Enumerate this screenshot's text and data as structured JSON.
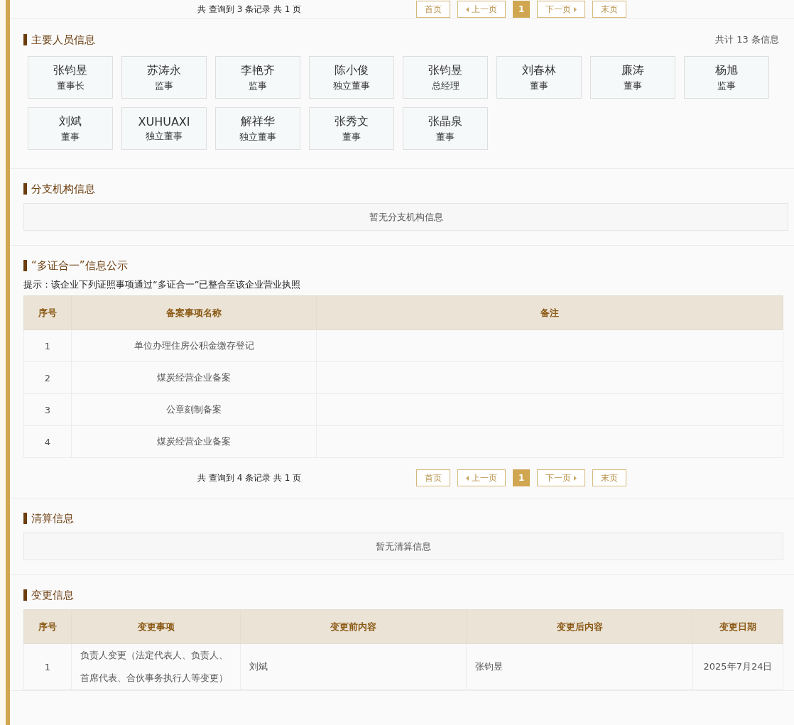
{
  "top_pagination": {
    "summary": "共 查询到 3 条记录 共 1 页",
    "buttons": [
      {
        "kind": "first",
        "label": "首页",
        "selected": false
      },
      {
        "kind": "prev",
        "label": "上一页",
        "selected": false
      },
      {
        "kind": "page",
        "label": "1",
        "selected": true
      },
      {
        "kind": "next",
        "label": "下一页",
        "selected": false
      },
      {
        "kind": "last",
        "label": "末页",
        "selected": false
      }
    ]
  },
  "personnel": {
    "title": "主要人员信息",
    "count": "共计 13 条信息",
    "people": [
      {
        "name": "张钧昱",
        "role": "董事长"
      },
      {
        "name": "苏涛永",
        "role": "监事"
      },
      {
        "name": "李艳齐",
        "role": "监事"
      },
      {
        "name": "陈小俊",
        "role": "独立董事"
      },
      {
        "name": "张钧昱",
        "role": "总经理"
      },
      {
        "name": "刘春林",
        "role": "董事"
      },
      {
        "name": "廉涛",
        "role": "董事"
      },
      {
        "name": "杨旭",
        "role": "监事"
      },
      {
        "name": "刘斌",
        "role": "董事"
      },
      {
        "name": "XUHUAXI",
        "role": "独立董事"
      },
      {
        "name": "解祥华",
        "role": "独立董事"
      },
      {
        "name": "张秀文",
        "role": "董事"
      },
      {
        "name": "张晶泉",
        "role": "董事"
      }
    ]
  },
  "branches": {
    "title": "分支机构信息",
    "empty": "暂无分支机构信息"
  },
  "multi_cert": {
    "title": "“多证合一”信息公示",
    "hint": "提示：该企业下列证照事项通过“多证合一”已整合至该企业营业执照",
    "columns": [
      "序号",
      "备案事项名称",
      "备注"
    ],
    "rows": [
      [
        "1",
        "单位办理住房公积金缴存登记",
        ""
      ],
      [
        "2",
        "煤炭经营企业备案",
        ""
      ],
      [
        "3",
        "公章刻制备案",
        ""
      ],
      [
        "4",
        "煤炭经营企业备案",
        ""
      ]
    ],
    "pagination": {
      "summary": "共 查询到 4 条记录 共 1 页",
      "buttons": [
        {
          "kind": "first",
          "label": "首页",
          "selected": false
        },
        {
          "kind": "prev",
          "label": "上一页",
          "selected": false
        },
        {
          "kind": "page",
          "label": "1",
          "selected": true
        },
        {
          "kind": "next",
          "label": "下一页",
          "selected": false
        },
        {
          "kind": "last",
          "label": "末页",
          "selected": false
        }
      ]
    }
  },
  "liquidation": {
    "title": "清算信息",
    "empty": "暂无清算信息"
  },
  "changes": {
    "title": "变更信息",
    "columns": [
      "序号",
      "变更事项",
      "变更前内容",
      "变更后内容",
      "变更日期"
    ],
    "rows": [
      [
        "1",
        "负责人变更（法定代表人、负责人、首席代表、合伙事务执行人等变更）",
        "刘斌",
        "张钧昱",
        "2025年7月24日"
      ]
    ]
  }
}
